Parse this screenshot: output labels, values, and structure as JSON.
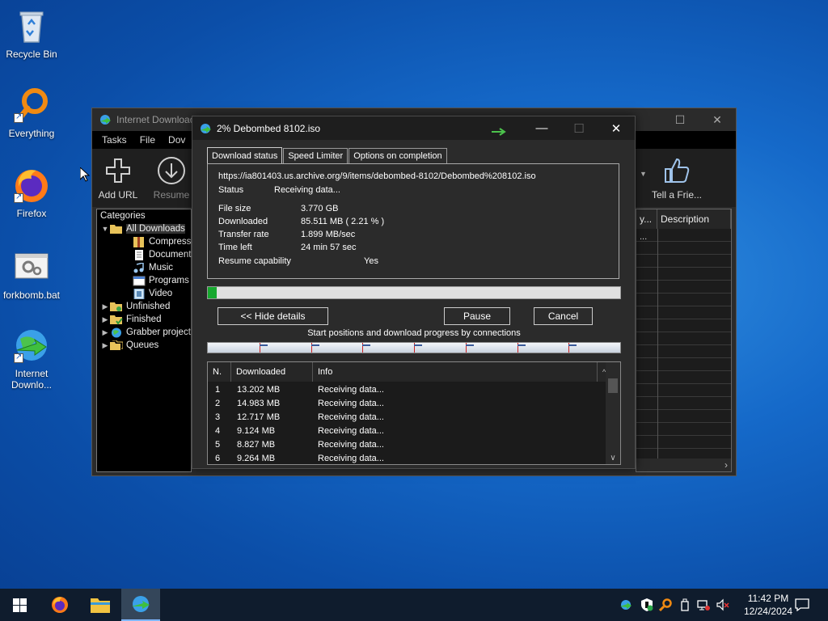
{
  "desktop": {
    "icons": [
      {
        "label": "Recycle Bin"
      },
      {
        "label": "Everything"
      },
      {
        "label": "Firefox"
      },
      {
        "label": "forkbomb.bat"
      },
      {
        "label": "Internet Downlo..."
      }
    ]
  },
  "idm_main": {
    "title": "Internet Download",
    "menu": [
      "Tasks",
      "File",
      "Dov"
    ],
    "toolbar": {
      "add_url": "Add URL",
      "resume": "Resume",
      "tell_friend": "Tell a Frie..."
    },
    "categories": {
      "header": "Categories",
      "items": [
        {
          "label": "All Downloads"
        },
        {
          "label": "Compressed"
        },
        {
          "label": "Documents"
        },
        {
          "label": "Music"
        },
        {
          "label": "Programs"
        },
        {
          "label": "Video"
        },
        {
          "label": "Unfinished"
        },
        {
          "label": "Finished"
        },
        {
          "label": "Grabber project"
        },
        {
          "label": "Queues"
        }
      ]
    },
    "list": {
      "columns": [
        "y...",
        "Description"
      ],
      "first_cell": "..."
    }
  },
  "dialog": {
    "title": "2% Debombed 8102.iso",
    "tabs": [
      "Download status",
      "Speed Limiter",
      "Options on completion"
    ],
    "url": "https://ia801403.us.archive.org/9/items/debombed-8102/Debombed%208102.iso",
    "status_label": "Status",
    "status_value": "Receiving data...",
    "file_size_label": "File size",
    "file_size_value": "3.770  GB",
    "downloaded_label": "Downloaded",
    "downloaded_value": "85.511  MB  ( 2.21 % )",
    "transfer_rate_label": "Transfer rate",
    "transfer_rate_value": "1.899  MB/sec",
    "time_left_label": "Time left",
    "time_left_value": "24 min 57 sec",
    "resume_label": "Resume capability",
    "resume_value": "Yes",
    "progress_fraction": 0.0221,
    "buttons": {
      "hide_details": "<< Hide details",
      "pause": "Pause",
      "cancel": "Cancel"
    },
    "connections_label": "Start positions and download progress by connections",
    "connections_table": {
      "columns": [
        "N.",
        "Downloaded",
        "Info"
      ],
      "rows": [
        {
          "n": "1",
          "downloaded": "13.202  MB",
          "info": "Receiving data..."
        },
        {
          "n": "2",
          "downloaded": "14.983  MB",
          "info": "Receiving data..."
        },
        {
          "n": "3",
          "downloaded": "12.717  MB",
          "info": "Receiving data..."
        },
        {
          "n": "4",
          "downloaded": "9.124  MB",
          "info": "Receiving data..."
        },
        {
          "n": "5",
          "downloaded": "8.827  MB",
          "info": "Receiving data..."
        },
        {
          "n": "6",
          "downloaded": "9.264  MB",
          "info": "Receiving data..."
        }
      ]
    }
  },
  "taskbar": {
    "time": "11:42 PM",
    "date": "12/24/2024"
  },
  "colors": {
    "progress_fill": "#17a82f",
    "connection_marker": "#cc2222",
    "taskbar_bg": "#0f1c2d"
  }
}
